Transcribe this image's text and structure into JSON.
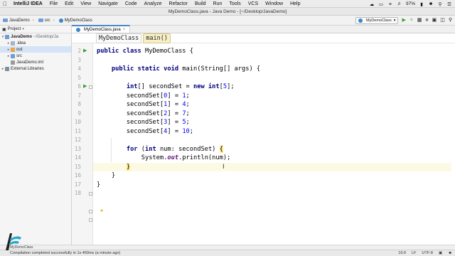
{
  "menubar": {
    "app_name": "IntelliJ IDEA",
    "items": [
      "File",
      "Edit",
      "View",
      "Navigate",
      "Code",
      "Analyze",
      "Refactor",
      "Build",
      "Run",
      "Tools",
      "VCS",
      "Window",
      "Help"
    ],
    "battery": "97%"
  },
  "window": {
    "title": "MyDemoClass.java - Java Demo - [~/Desktop/JavaDemo]"
  },
  "navbar": {
    "crumbs": [
      "JavaDemo",
      "src",
      "MyDemoClass"
    ],
    "run_config": "MyDemoClass"
  },
  "project_panel": {
    "header": "Project",
    "tree": [
      {
        "label": "JavaDemo",
        "extra": "~/Desktop/Ja"
      },
      {
        "label": ".idea"
      },
      {
        "label": "out"
      },
      {
        "label": "src"
      },
      {
        "label": "JavaDemo.iml"
      },
      {
        "label": "External Libraries"
      }
    ]
  },
  "editor": {
    "tab_label": "MyDemoClass.java",
    "structure_crumbs": [
      "MyDemoClass",
      "main()"
    ],
    "line_numbers": [
      "2",
      "3",
      "4",
      "5",
      "6",
      "7",
      "8",
      "9",
      "10",
      "11",
      "12",
      "13",
      "14",
      "15",
      "16",
      "17",
      "18"
    ],
    "code": {
      "l2_kw": "public class",
      "l2_rest": " MyDemoClass {",
      "l4_kw1": "public static void",
      "l4_rest": " main(String[] args) {",
      "l6_kw1": "int",
      "l6_mid": "[] secondSet = ",
      "l6_kw2": "new int",
      "l6_br1": "[",
      "l6_num": "5",
      "l6_br2": "];",
      "assign_lines": [
        {
          "prefix": "secondSet[",
          "idx": "0",
          "mid": "] = ",
          "val": "1",
          "end": ";"
        },
        {
          "prefix": "secondSet[",
          "idx": "1",
          "mid": "] = ",
          "val": "4",
          "end": ";"
        },
        {
          "prefix": "secondSet[",
          "idx": "2",
          "mid": "] = ",
          "val": "7",
          "end": ";"
        },
        {
          "prefix": "secondSet[",
          "idx": "3",
          "mid": "] = ",
          "val": "5",
          "end": ";"
        },
        {
          "prefix": "secondSet[",
          "idx": "4",
          "mid": "] = ",
          "val": "10",
          "end": ";"
        }
      ],
      "l13_kw1": "for",
      "l13_p1": " (",
      "l13_kw2": "int",
      "l13_rest": " num: secondSet) ",
      "l13_brace": "{",
      "l14_pre": "System.",
      "l14_out": "out",
      "l14_rest": ".println(num);",
      "l15_brace": "}",
      "l16": "}",
      "l17": "}"
    }
  },
  "bottom": {
    "tool_tab": "MyDemoClass",
    "status_message": "Compilation completed successfully in 1s 469ms (a minute ago)",
    "cursor_pos": "16:9",
    "line_sep": "LF",
    "encoding": "UTF-8"
  }
}
